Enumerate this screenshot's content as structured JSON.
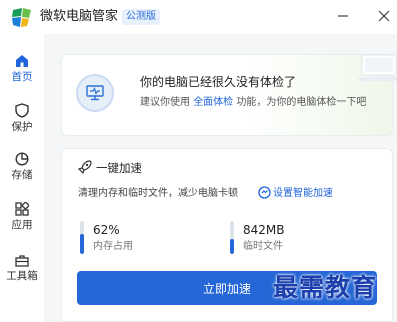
{
  "app": {
    "title": "微软电脑管家",
    "badge": "公测版"
  },
  "sidebar": {
    "items": [
      {
        "label": "首页",
        "icon": "home-icon",
        "active": true
      },
      {
        "label": "保护",
        "icon": "shield-icon",
        "active": false
      },
      {
        "label": "存储",
        "icon": "storage-pie-icon",
        "active": false
      },
      {
        "label": "应用",
        "icon": "apps-grid-icon",
        "active": false
      },
      {
        "label": "工具箱",
        "icon": "toolbox-icon",
        "active": false
      }
    ]
  },
  "status_card": {
    "title": "你的电脑已经很久没有体检了",
    "desc_prefix": "建议你使用",
    "desc_link": "全面体检",
    "desc_suffix": "功能，为你的电脑体检一下吧"
  },
  "accel_card": {
    "title": "一键加速",
    "desc": "清理内存和临时文件，减少电脑卡顿",
    "setting_link": "设置智能加速",
    "memory": {
      "value": "62%",
      "label": "内存占用",
      "fill_fraction": 0.62
    },
    "temp": {
      "value": "842MB",
      "label": "临时文件",
      "fill_fraction": 0.45
    },
    "button": "立即加速"
  },
  "watermark": "最需教育",
  "colors": {
    "accent": "#2567d6",
    "active_nav": "#1f64d8"
  }
}
